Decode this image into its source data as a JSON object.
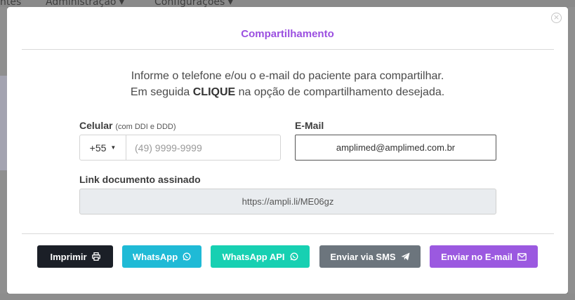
{
  "background": {
    "nav_items": [
      "ntes",
      "Administração ▾",
      "Configurações ▾"
    ]
  },
  "modal": {
    "title": "Compartilhamento",
    "instructions_line1": "Informe o telefone e/ou o e-mail do paciente para compartilhar.",
    "instructions_line2_pre": "Em seguida ",
    "instructions_line2_bold": "CLIQUE",
    "instructions_line2_post": " na opção de compartilhamento desejada.",
    "phone": {
      "label": "Celular",
      "hint": "(com DDI e DDD)",
      "ddi_value": "+55",
      "placeholder": "(49) 9999-9999"
    },
    "email": {
      "label": "E-Mail",
      "value": "amplimed@amplimed.com.br"
    },
    "link": {
      "label": "Link documento assinado",
      "value": "https://ampli.li/ME06gz"
    },
    "buttons": [
      {
        "label": "Imprimir",
        "icon": "printer-icon",
        "color": "#1b1f27"
      },
      {
        "label": "WhatsApp",
        "icon": "whatsapp-icon",
        "color": "#1fbad6"
      },
      {
        "label": "WhatsApp API",
        "icon": "whatsapp-icon",
        "color": "#17d0b2"
      },
      {
        "label": "Enviar via SMS",
        "icon": "paper-plane-icon",
        "color": "#6c757d"
      },
      {
        "label": "Enviar no E-mail",
        "icon": "envelope-icon",
        "color": "#9b59e0"
      }
    ]
  }
}
